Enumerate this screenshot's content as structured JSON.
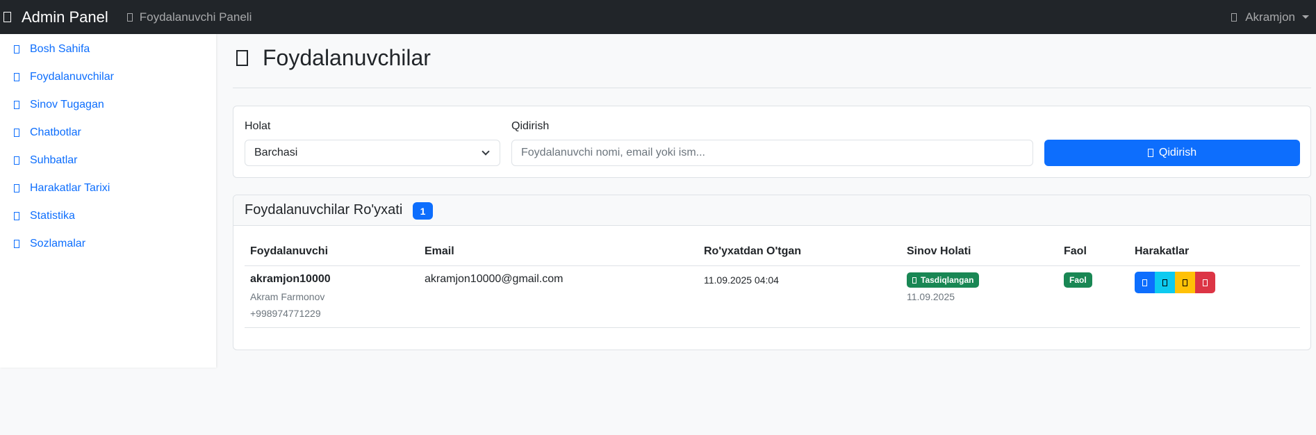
{
  "topbar": {
    "brand": "Admin Panel",
    "brand_icon": "grid-icon",
    "panel_link": "Foydalanuvchi Paneli",
    "user": "Akramjon"
  },
  "sidebar": {
    "items": [
      {
        "label": "Bosh Sahifa",
        "icon": "home-icon"
      },
      {
        "label": "Foydalanuvchilar",
        "icon": "users-icon"
      },
      {
        "label": "Sinov Tugagan",
        "icon": "clock-icon"
      },
      {
        "label": "Chatbotlar",
        "icon": "robot-icon"
      },
      {
        "label": "Suhbatlar",
        "icon": "chat-icon"
      },
      {
        "label": "Harakatlar Tarixi",
        "icon": "history-icon"
      },
      {
        "label": "Statistika",
        "icon": "chart-icon"
      },
      {
        "label": "Sozlamalar",
        "icon": "gear-icon"
      }
    ]
  },
  "page": {
    "title": "Foydalanuvchilar"
  },
  "filters": {
    "status_label": "Holat",
    "status_value": "Barchasi",
    "search_label": "Qidirish",
    "search_placeholder": "Foydalanuvchi nomi, email yoki ism...",
    "search_button": "Qidirish"
  },
  "list": {
    "title": "Foydalanuvchilar Ro'yxati",
    "count": "1",
    "columns": [
      "Foydalanuvchi",
      "Email",
      "Ro'yxatdan O'tgan",
      "Sinov Holati",
      "Faol",
      "Harakatlar"
    ],
    "rows": [
      {
        "username": "akramjon10000",
        "full_name": "Akram Farmonov",
        "phone": "+998974771229",
        "email": "akramjon10000@gmail.com",
        "registered": "11.09.2025 04:04",
        "trial_status": "Tasdiqlangan",
        "trial_date": "11.09.2025",
        "active": "Faol"
      }
    ]
  },
  "colors": {
    "primary": "#0d6efd",
    "info": "#0dcaf0",
    "warning": "#ffc107",
    "danger": "#dc3545",
    "success": "#198754",
    "navbar": "#212529"
  },
  "actions": [
    "view-icon",
    "edit-icon",
    "pause-icon",
    "delete-icon"
  ]
}
